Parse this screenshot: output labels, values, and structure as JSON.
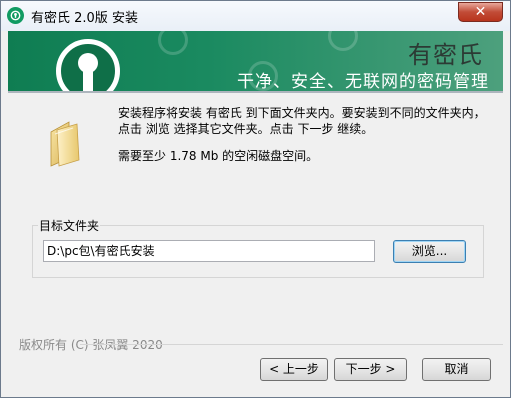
{
  "window": {
    "title": "有密氏 2.0版 安装",
    "close_glyph": "✕"
  },
  "banner": {
    "name": "有密氏",
    "slogan": "干净、安全、无联网的密码管理",
    "brand_color": "#119b62"
  },
  "content": {
    "intro": "安装程序将安装 有密氏 到下面文件夹内。要安装到不同的文件夹内，点击 浏览 选择其它文件夹。点击 下一步 继续。",
    "space_required": "需要至少 1.78 Mb 的空闲磁盘空间。"
  },
  "destination": {
    "label": "目标文件夹",
    "path": "D:\\pc包\\有密氏安装",
    "browse_label": "浏览..."
  },
  "footer": {
    "copyright": "版权所有 (C) 张凤翼 2020",
    "back_label": "< 上一步",
    "next_label": "下一步 >",
    "cancel_label": "取消"
  }
}
